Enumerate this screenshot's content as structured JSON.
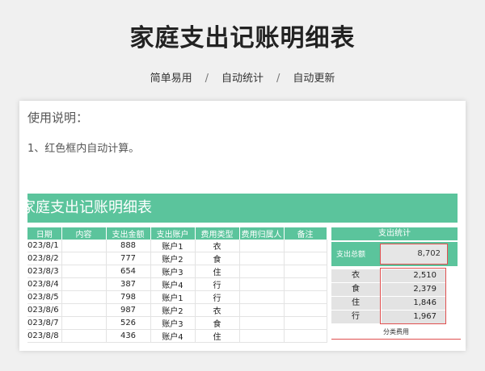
{
  "page": {
    "title": "家庭支出记账明细表",
    "tags": [
      "简单易用",
      "自动统计",
      "自动更新"
    ],
    "separator": "/"
  },
  "instructions": {
    "heading": "使用说明：",
    "line1": "1、红色框内自动计算。"
  },
  "sheet": {
    "banner": "家庭支出记账明细表",
    "columns": [
      "日期",
      "内容",
      "支出金额",
      "支出账户",
      "费用类型",
      "费用归属人",
      "备注"
    ],
    "rows": [
      {
        "date": "023/8/1",
        "content": "",
        "amount": "888",
        "account": "账户1",
        "type": "衣",
        "owner": "",
        "note": ""
      },
      {
        "date": "023/8/2",
        "content": "",
        "amount": "777",
        "account": "账户2",
        "type": "食",
        "owner": "",
        "note": ""
      },
      {
        "date": "023/8/3",
        "content": "",
        "amount": "654",
        "account": "账户3",
        "type": "住",
        "owner": "",
        "note": ""
      },
      {
        "date": "023/8/4",
        "content": "",
        "amount": "387",
        "account": "账户4",
        "type": "行",
        "owner": "",
        "note": ""
      },
      {
        "date": "023/8/5",
        "content": "",
        "amount": "798",
        "account": "账户1",
        "type": "行",
        "owner": "",
        "note": ""
      },
      {
        "date": "023/8/6",
        "content": "",
        "amount": "987",
        "account": "账户2",
        "type": "衣",
        "owner": "",
        "note": ""
      },
      {
        "date": "023/8/7",
        "content": "",
        "amount": "526",
        "account": "账户3",
        "type": "食",
        "owner": "",
        "note": ""
      },
      {
        "date": "023/8/8",
        "content": "",
        "amount": "436",
        "account": "账户4",
        "type": "住",
        "owner": "",
        "note": ""
      }
    ]
  },
  "stats": {
    "header": "支出统计",
    "total_label": "支出总额",
    "total_value": "8,702",
    "categories": [
      {
        "name": "衣",
        "value": "2,510"
      },
      {
        "name": "食",
        "value": "2,379"
      },
      {
        "name": "住",
        "value": "1,846"
      },
      {
        "name": "行",
        "value": "1,967"
      }
    ],
    "category_caption": "分类费用"
  },
  "colors": {
    "accent": "#5bc49c",
    "highlight_border": "#e05050"
  }
}
